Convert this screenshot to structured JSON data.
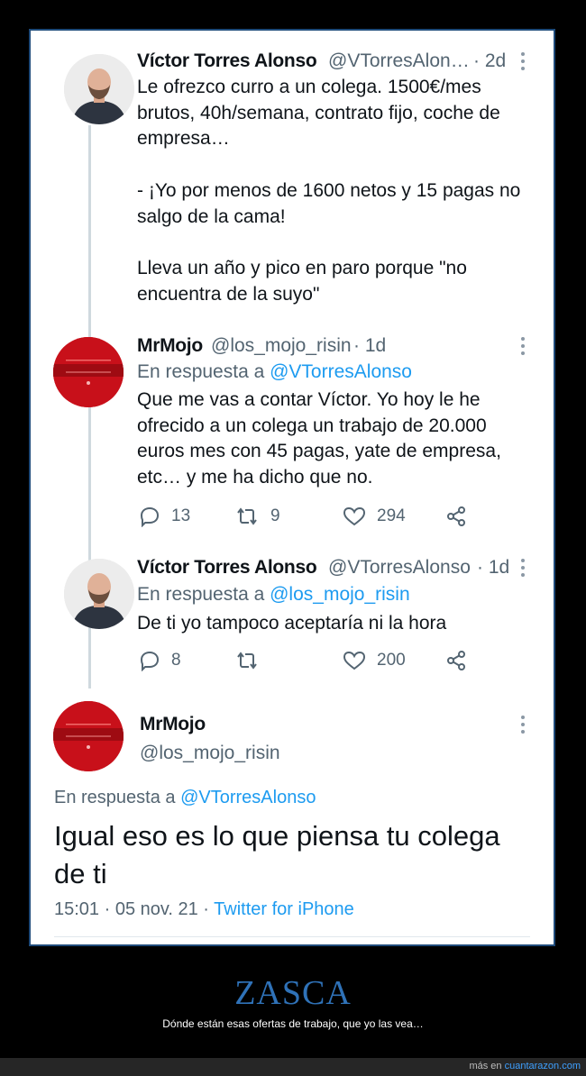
{
  "tweets": [
    {
      "name": "Víctor Torres Alonso",
      "handle": "@VTorresAlon…",
      "time": "· 2d",
      "body": "Le ofrezco curro a un colega. 1500€/mes brutos, 40h/semana, contrato fijo, coche de empresa…\n\n- ¡Yo por menos de 1600 netos y 15 pagas no salgo de la cama!\n\nLleva un año y pico en paro porque \"no encuentra de la suyo\""
    },
    {
      "name": "MrMojo",
      "handle": "@los_mojo_risin",
      "time": "· 1d",
      "reply_prefix": "En respuesta a",
      "reply_to": "@VTorresAlonso",
      "body": "Que me vas a contar Víctor. Yo hoy le he ofrecido a un colega un trabajo de 20.000 euros mes con 45 pagas, yate de empresa, etc… y me ha dicho que no.",
      "replies": "13",
      "retweets": "9",
      "likes": "294"
    },
    {
      "name": "Víctor Torres Alonso",
      "handle": "@VTorresAlonso",
      "time": "· 1d",
      "reply_prefix": "En respuesta a",
      "reply_to": "@los_mojo_risin",
      "body": "De ti yo tampoco aceptaría ni la hora",
      "replies": "8",
      "likes": "200"
    }
  ],
  "main_tweet": {
    "name": "MrMojo",
    "handle": "@los_mojo_risin",
    "reply_prefix": "En respuesta a",
    "reply_to": "@VTorresAlonso",
    "body": "Igual eso es lo que piensa tu colega de ti",
    "timestamp": "15:01 · 05 nov. 21 ·",
    "source": "Twitter for iPhone"
  },
  "footer": {
    "title": "ZASCA",
    "subtitle": "Dónde están esas ofertas de trabajo, que yo las vea…",
    "credit_prefix": "más en",
    "credit_link": "cuantarazon.com"
  },
  "colors": {
    "link": "#1d9bf0",
    "footer_title": "#2f72b8",
    "avatar_red": "#c8101a"
  }
}
